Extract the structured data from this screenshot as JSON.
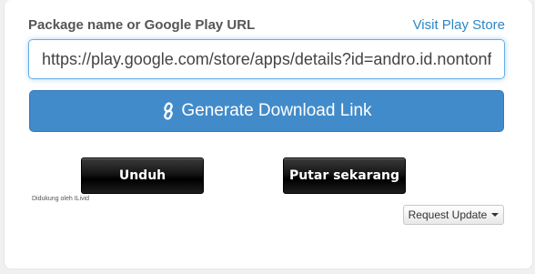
{
  "form": {
    "package_label": "Package name or Google Play URL",
    "visit_link": "Visit Play Store",
    "url_value": "https://play.google.com/store/apps/details?id=andro.id.nontonfilm",
    "generate_label": "Generate Download Link"
  },
  "actions": {
    "download_label": "Unduh",
    "play_label": "Putar sekarang",
    "support_text": "Didukung oleh ILivid"
  },
  "request": {
    "label": "Request Update"
  },
  "icons": {
    "generate": "link-icon",
    "request": "caret-down-icon"
  },
  "colors": {
    "primary": "#428bca",
    "link": "#2d86c4",
    "dark_button": "#000000"
  }
}
